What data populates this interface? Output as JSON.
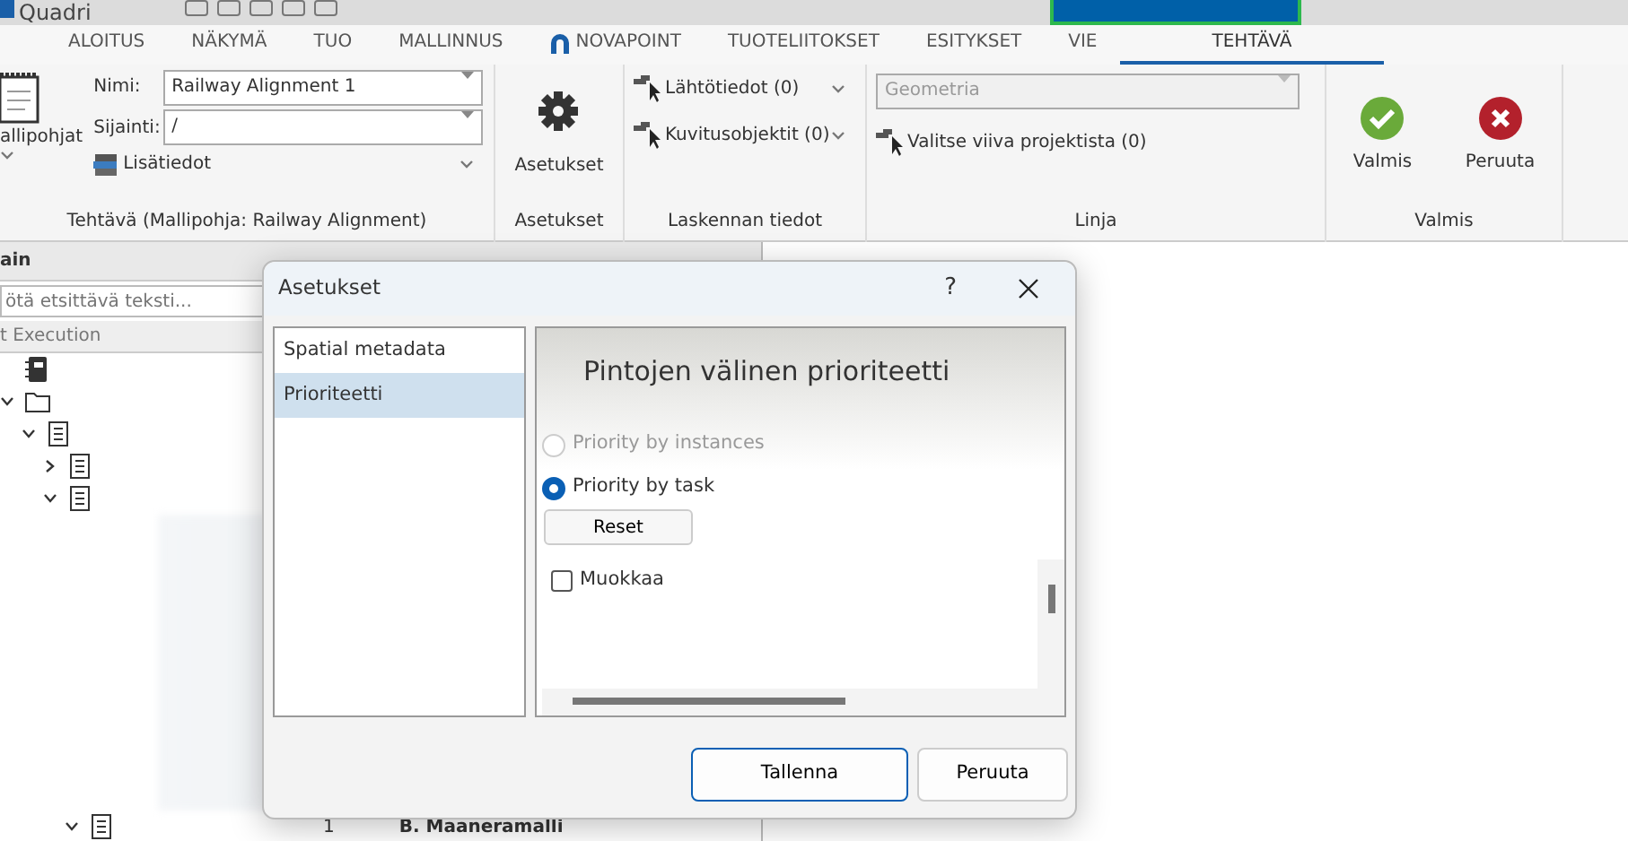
{
  "app": {
    "title": "Quadri"
  },
  "ribbon_tabs": [
    {
      "label": "ALOITUS",
      "kind": "plain",
      "selected": false
    },
    {
      "label": "NÄKYMÄ",
      "kind": "plain",
      "selected": false
    },
    {
      "label": "TUO",
      "kind": "plain",
      "selected": false
    },
    {
      "label": "MALLINNUS",
      "kind": "plain",
      "selected": false
    },
    {
      "label": "NOVAPOINT",
      "kind": "logo",
      "selected": false
    },
    {
      "label": "TUOTELIITOKSET",
      "kind": "plain",
      "selected": false
    },
    {
      "label": "ESITYKSET",
      "kind": "plain",
      "selected": false
    },
    {
      "label": "VIE",
      "kind": "plain",
      "selected": false
    },
    {
      "label": "TEHTÄVÄ",
      "kind": "plain",
      "selected": true
    }
  ],
  "task_group": {
    "template_button": "allipohjat",
    "name_label": "Nimi:",
    "name_value": "Railway Alignment 1",
    "location_label": "Sijainti:",
    "location_value": "/",
    "more_info": "Lisätiedot",
    "label": "Tehtävä   (Mallipohja: Railway Alignment)"
  },
  "settings_group": {
    "button": "Asetukset",
    "label": "Asetukset"
  },
  "calc_group": {
    "items": [
      "Lähtötiedot (0)",
      "Kuvitusobjektit (0)"
    ],
    "label": "Laskennan tiedot"
  },
  "line_group": {
    "dropdown": {
      "value": "Geometria",
      "disabled": true
    },
    "pick": "Valitse viiva projektista (0)",
    "label": "Linja"
  },
  "done_group": {
    "ok": "Valmis",
    "cancel": "Peruuta",
    "label": "Valmis"
  },
  "left_panel": {
    "title": "ain",
    "search": {
      "placeholder": "ötä etsittävä teksti..."
    },
    "column": "t Execution",
    "tree": [
      {
        "kind": "book",
        "children": [
          {
            "kind": "folder",
            "expanded": true,
            "children": [
              {
                "kind": "doc",
                "expanded": true,
                "children": [
                  {
                    "kind": "doc",
                    "expanded": false
                  },
                  {
                    "kind": "doc",
                    "expanded": true,
                    "children": [
                      {
                        "kind": "blurred"
                      },
                      {
                        "kind": "doc",
                        "expanded": true,
                        "number": "1",
                        "label": "B. Maaneramalli"
                      }
                    ]
                  }
                ]
              }
            ]
          }
        ]
      }
    ]
  },
  "dialog": {
    "title": "Asetukset",
    "help": "?",
    "nav": [
      {
        "label": "Spatial metadata",
        "selected": false
      },
      {
        "label": "Prioriteetti",
        "selected": true
      }
    ],
    "heading": "Pintojen välinen prioriteetti",
    "radios": [
      {
        "label": "Priority by instances",
        "selected": false,
        "disabled": true
      },
      {
        "label": "Priority by task",
        "selected": true,
        "disabled": false
      }
    ],
    "reset": "Reset",
    "checkbox": {
      "label": "Muokkaa",
      "checked": false
    },
    "buttons": [
      {
        "label": "Tallenna",
        "default": true
      },
      {
        "label": "Peruuta",
        "default": false
      }
    ]
  }
}
